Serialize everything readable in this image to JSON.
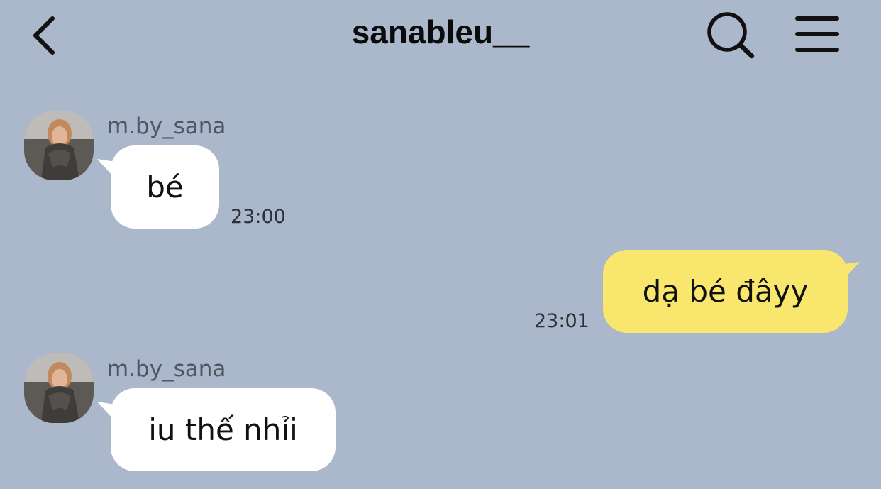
{
  "header": {
    "title": "sanableu__"
  },
  "messages": [
    {
      "sender": "m.by_sana",
      "text": "bé",
      "time": "23:00",
      "direction": "incoming"
    },
    {
      "sender": "",
      "text": "dạ bé đâyy",
      "time": "23:01",
      "direction": "outgoing"
    },
    {
      "sender": "m.by_sana",
      "text": "iu thế nhỉi",
      "time": "",
      "direction": "incoming"
    }
  ],
  "icons": [
    "back-icon",
    "search-icon",
    "menu-icon"
  ],
  "colors": {
    "background": "#abb7ca",
    "incoming_bubble": "#ffffff",
    "outgoing_bubble": "#f8e76c",
    "text": "#111111"
  }
}
